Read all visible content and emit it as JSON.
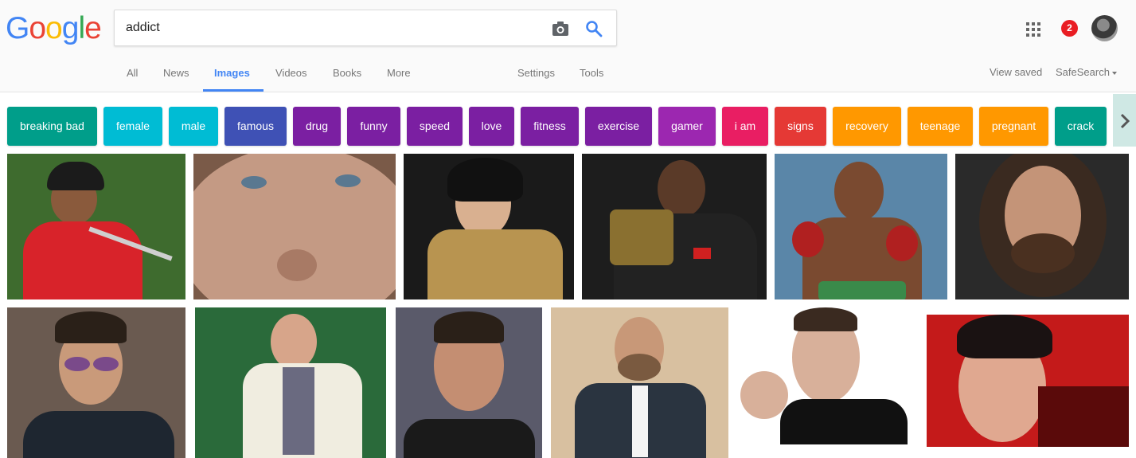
{
  "logo": {
    "letters": [
      "G",
      "o",
      "o",
      "g",
      "l",
      "e"
    ],
    "colors": [
      "#4285f4",
      "#ea4335",
      "#fbbc05",
      "#4285f4",
      "#34a853",
      "#ea4335"
    ]
  },
  "search": {
    "value": "addict",
    "camera_icon": "camera-icon",
    "search_icon": "search-icon"
  },
  "account": {
    "notification_count": "2",
    "apps_icon": "apps-grid-icon"
  },
  "tabs": [
    {
      "label": "All",
      "active": false
    },
    {
      "label": "News",
      "active": false
    },
    {
      "label": "Images",
      "active": true
    },
    {
      "label": "Videos",
      "active": false
    },
    {
      "label": "Books",
      "active": false
    },
    {
      "label": "More",
      "active": false
    }
  ],
  "tools": {
    "settings": "Settings",
    "tools": "Tools"
  },
  "right_links": {
    "view_saved": "View saved",
    "safesearch": "SafeSearch"
  },
  "chips": [
    {
      "label": "breaking bad",
      "color": "#009e8a"
    },
    {
      "label": "female",
      "color": "#00bcd4"
    },
    {
      "label": "male",
      "color": "#00bcd4"
    },
    {
      "label": "famous",
      "color": "#3f51b5"
    },
    {
      "label": "drug",
      "color": "#7b1fa2"
    },
    {
      "label": "funny",
      "color": "#7b1fa2"
    },
    {
      "label": "speed",
      "color": "#7b1fa2"
    },
    {
      "label": "love",
      "color": "#7b1fa2"
    },
    {
      "label": "fitness",
      "color": "#7b1fa2"
    },
    {
      "label": "exercise",
      "color": "#7b1fa2"
    },
    {
      "label": "gamer",
      "color": "#9c27b0"
    },
    {
      "label": "i am",
      "color": "#e91e63"
    },
    {
      "label": "signs",
      "color": "#e53935"
    },
    {
      "label": "recovery",
      "color": "#ff9800"
    },
    {
      "label": "teenage",
      "color": "#ff9800"
    },
    {
      "label": "pregnant",
      "color": "#ff9800"
    },
    {
      "label": "crack",
      "color": "#009e8a"
    }
  ],
  "images": [
    {
      "bg": "#3e6b2e",
      "skin": "#8a5a3c",
      "shirt": "#d8232a"
    },
    {
      "bg": "#7a5a48",
      "skin": "#c49a84",
      "shirt": "#a27865"
    },
    {
      "bg": "#1a1a1a",
      "skin": "#d9b090",
      "shirt": "#b89450"
    },
    {
      "bg": "#1d1d1d",
      "skin": "#5a3a28",
      "shirt": "#222222"
    },
    {
      "bg": "#5a86a8",
      "skin": "#7a4a30",
      "shirt": "#3a8a4a"
    },
    {
      "bg": "#2a2a2a",
      "skin": "#c49478",
      "shirt": "#3a2a20"
    },
    {
      "bg": "#6a5a50",
      "skin": "#c99a7a",
      "shirt": "#1e2630"
    },
    {
      "bg": "#2a6a3a",
      "skin": "#d7a58a",
      "shirt": "#f0ede0"
    },
    {
      "bg": "#5a5a6a",
      "skin": "#c48e72",
      "shirt": "#1a1a1a"
    },
    {
      "bg": "#d8c0a0",
      "skin": "#c89878",
      "shirt": "#2a3440"
    },
    {
      "bg": "#ffffff",
      "skin": "#d8b09a",
      "shirt": "#111111"
    },
    {
      "bg": "#c41a1a",
      "skin": "#e0a890",
      "shirt": "#5a0a0a"
    }
  ]
}
